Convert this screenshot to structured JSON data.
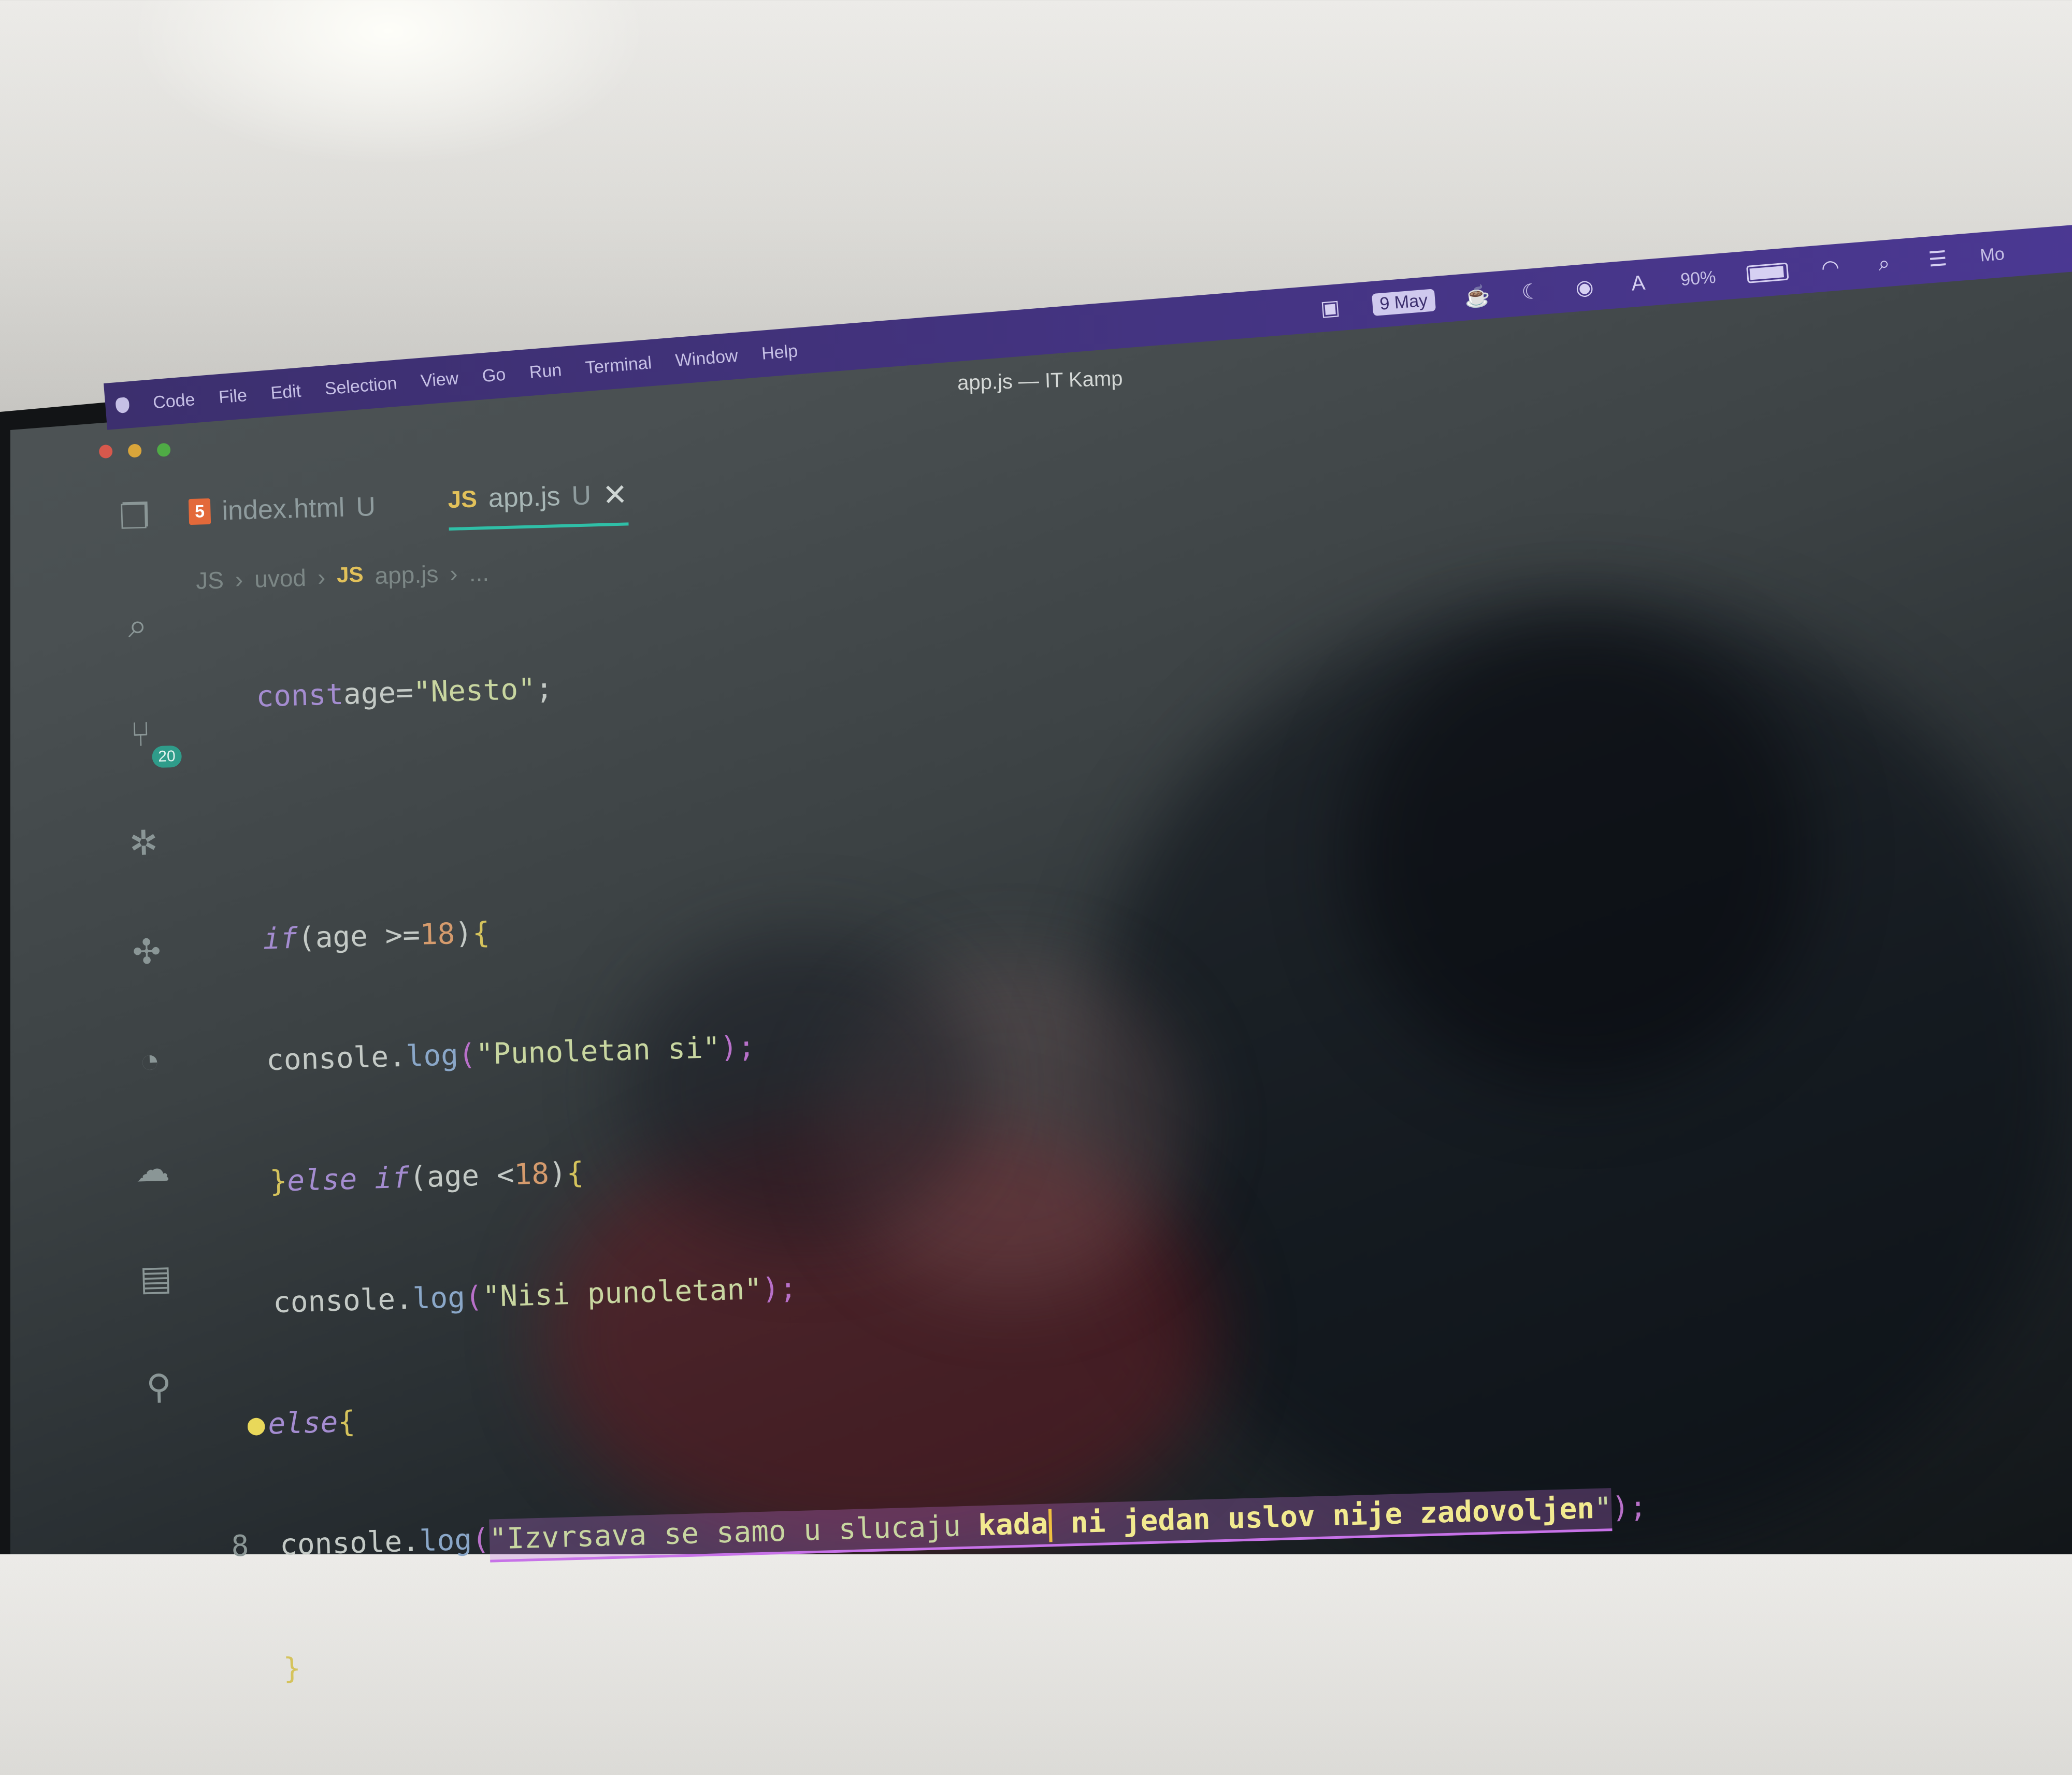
{
  "menubar": {
    "items": [
      "Code",
      "File",
      "Edit",
      "Selection",
      "View",
      "Go",
      "Run",
      "Terminal",
      "Window",
      "Help"
    ],
    "date": "9 May",
    "battery": "90%",
    "clock_partial": "Mo"
  },
  "window": {
    "title": "app.js — IT Kamp"
  },
  "activity_bar": {
    "icons": [
      "files-icon",
      "search-icon",
      "source-control-icon",
      "debug-icon",
      "extensions-icon",
      "git-graph-icon",
      "docker-icon",
      "database-icon",
      "python-icon"
    ],
    "source_control_badge": "20"
  },
  "tabs": [
    {
      "icon": "5",
      "label": "index.html",
      "status": "U",
      "active": false
    },
    {
      "icon": "JS",
      "label": "app.js",
      "status": "U",
      "active": true
    }
  ],
  "breadcrumb": {
    "root": "JS",
    "folder": "uvod",
    "icon": "JS",
    "file": "app.js",
    "rest": "..."
  },
  "code": {
    "current_line_number": "8",
    "lines": [
      {
        "kw": "const",
        "ident": "age",
        "op": "=",
        "str": "\"Nesto\"",
        "end": ";"
      },
      {},
      {
        "kw": "if",
        "pre": "(age >=",
        "num": "18",
        "post": ")",
        "brace": "{"
      },
      {
        "obj": "console.",
        "fn": "log",
        "str": "\"Punoletan si\"",
        "end": ");"
      },
      {
        "brace1": "}",
        "kw": "else if",
        "pre": "(age <",
        "num": "18",
        "post": ")",
        "brace": "{"
      },
      {
        "obj": "console.",
        "fn": "log",
        "str": "\"Nisi punoletan\"",
        "end": ");"
      },
      {
        "kw": "else",
        "brace": "{"
      },
      {
        "obj": "console.",
        "fn": "log",
        "str_a": "\"Izvrsava se samo u slucaju ",
        "str_b": "kada",
        "str_c": " ni jedan uslov nije zadovoljen",
        "str_d": "\"",
        "end": ");"
      },
      {
        "brace": "}"
      }
    ]
  },
  "colors": {
    "menubar": "#4b3893",
    "accent_tab": "#2fbfa7",
    "keyword": "#a48cd0",
    "string": "#c8d6a0",
    "number": "#d59b6d",
    "cursor": "#f0c040"
  }
}
